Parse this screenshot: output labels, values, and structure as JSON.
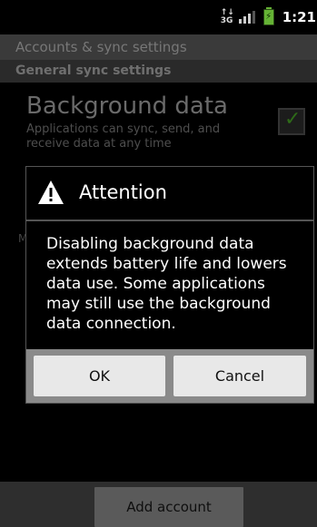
{
  "status_bar": {
    "network": "3G",
    "time": "1:21"
  },
  "screen": {
    "title": "Accounts & sync settings",
    "section_header": "General sync settings"
  },
  "background_data": {
    "title": "Background data",
    "summary": "Applications can sync, send, and receive data at any time",
    "checked": true
  },
  "auto_sync": {
    "checked": true
  },
  "manage_accounts_letter": "M",
  "dialog": {
    "title": "Attention",
    "message": "Disabling background data extends battery life and lowers data use. Some applications may still use the background data connection.",
    "ok_label": "OK",
    "cancel_label": "Cancel"
  },
  "bottom": {
    "add_account_label": "Add account"
  },
  "colors": {
    "checkmark": "#2e6b18",
    "battery": "#65b335",
    "dialog_buttons_bg": "#8a8a8a"
  }
}
